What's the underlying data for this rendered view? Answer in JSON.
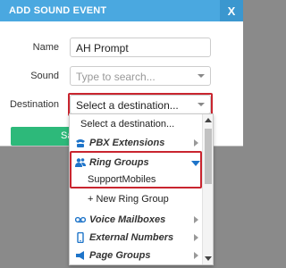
{
  "dialog": {
    "title": "ADD SOUND EVENT",
    "close_label": "X"
  },
  "form": {
    "name_label": "Name",
    "name_value": "AH Prompt",
    "sound_label": "Sound",
    "sound_placeholder": "Type to search...",
    "destination_label": "Destination",
    "destination_value": "Select a destination...",
    "save_partial_label": "Sa"
  },
  "dropdown": {
    "first_option": "Select a destination...",
    "groups": [
      {
        "label": "PBX Extensions",
        "icon": "phone-icon"
      },
      {
        "label": "Ring Groups",
        "icon": "users-icon",
        "expanded": true,
        "items": [
          "SupportMobiles"
        ],
        "add_label": "+ New Ring Group"
      },
      {
        "label": "Voice Mailboxes",
        "icon": "voicemail-icon"
      },
      {
        "label": "External Numbers",
        "icon": "mobile-phone-icon"
      },
      {
        "label": "Page Groups",
        "icon": "megaphone-icon"
      }
    ]
  },
  "colors": {
    "titlebar": "#4aa8e0",
    "highlight": "#c9252f",
    "save_button": "#2db97a",
    "icon_blue": "#1e74c9"
  }
}
